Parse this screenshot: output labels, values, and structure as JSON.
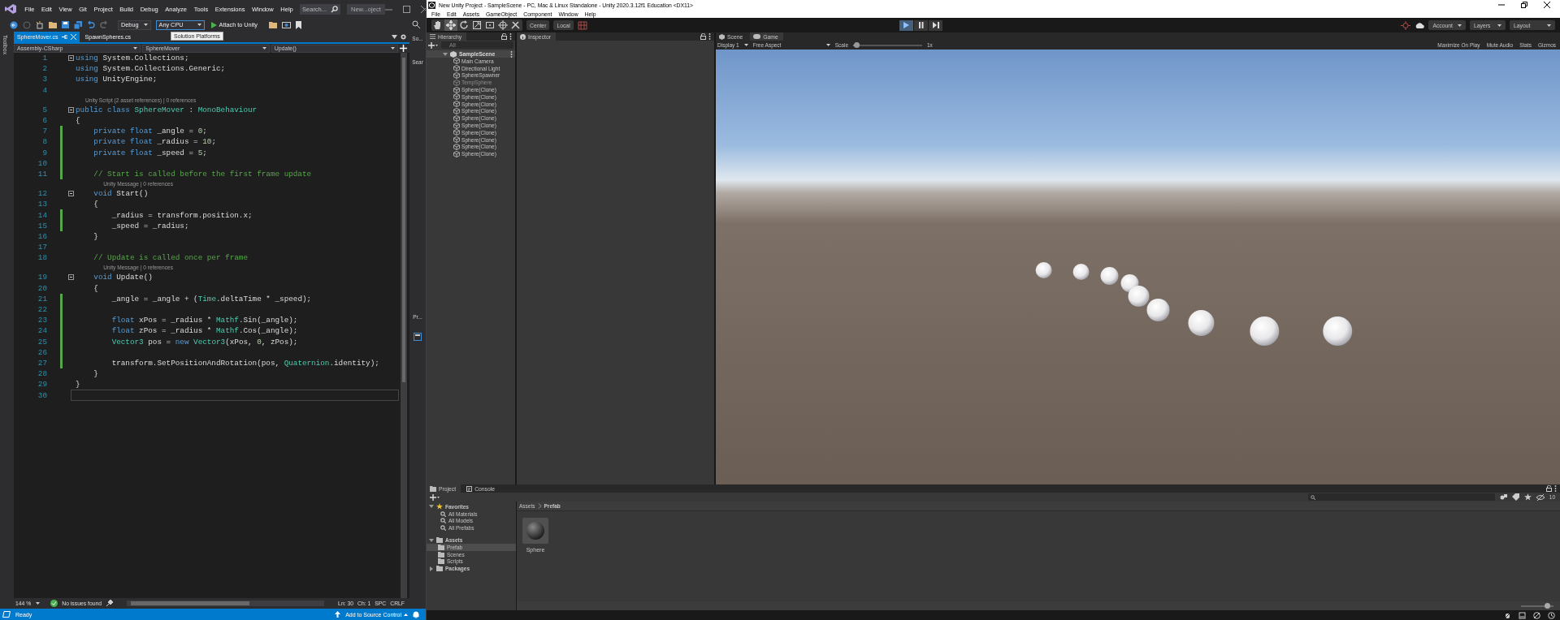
{
  "vs": {
    "menus": [
      "File",
      "Edit",
      "View",
      "Git",
      "Project",
      "Build",
      "Debug",
      "Analyze",
      "Tools",
      "Extensions",
      "Window",
      "Help"
    ],
    "search": {
      "placeholder": "Search..."
    },
    "title": "New...oject",
    "toolbar": {
      "configuration": "Debug",
      "platform": "Any CPU",
      "run_label": "Attach to Unity"
    },
    "tooltip": "Solution Platforms",
    "side_left": "Toolbox",
    "side_right": {
      "top": "So...",
      "search": "Sear",
      "bottom": "Pr..."
    },
    "tabs": [
      {
        "label": "SphereMover.cs",
        "selected": true
      },
      {
        "label": "SpawnSpheres.cs",
        "selected": false
      }
    ],
    "nav": {
      "project": "Assembly-CSharp",
      "type": "SphereMover",
      "member": "Update()"
    },
    "code": [
      {
        "number": "1",
        "foldable": true,
        "changed": false,
        "tokens": [
          {
            "kind": "kw",
            "text": "using"
          },
          {
            "kind": "plain",
            "text": " System.Collections;"
          }
        ]
      },
      {
        "number": "2",
        "foldable": false,
        "changed": false,
        "tokens": [
          {
            "kind": "kw",
            "text": "using"
          },
          {
            "kind": "plain",
            "text": " System.Collections.Generic;"
          }
        ]
      },
      {
        "number": "3",
        "foldable": false,
        "changed": false,
        "tokens": [
          {
            "kind": "kw",
            "text": "using"
          },
          {
            "kind": "plain",
            "text": " UnityEngine;"
          }
        ]
      },
      {
        "number": "4",
        "foldable": false,
        "changed": false
      },
      {
        "kind": "lens",
        "text": "Unity Script (2 asset references) | 0 references"
      },
      {
        "number": "5",
        "foldable": true,
        "changed": false,
        "tokens": [
          {
            "kind": "kw",
            "text": "public class "
          },
          {
            "kind": "type",
            "text": "SphereMover"
          },
          {
            "kind": "plain",
            "text": " : "
          },
          {
            "kind": "type",
            "text": "MonoBehaviour"
          }
        ]
      },
      {
        "number": "6",
        "foldable": false,
        "changed": false,
        "tokens": [
          {
            "kind": "plain",
            "text": "{"
          }
        ]
      },
      {
        "number": "7",
        "foldable": false,
        "changed": true,
        "tokens": [
          {
            "kind": "kw",
            "text": "    private float"
          },
          {
            "kind": "plain",
            "text": " _angle = "
          },
          {
            "kind": "num",
            "text": "0"
          },
          {
            "kind": "plain",
            "text": ";"
          }
        ]
      },
      {
        "number": "8",
        "foldable": false,
        "changed": true,
        "tokens": [
          {
            "kind": "kw",
            "text": "    private float"
          },
          {
            "kind": "plain",
            "text": " _radius = "
          },
          {
            "kind": "num",
            "text": "10"
          },
          {
            "kind": "plain",
            "text": ";"
          }
        ]
      },
      {
        "number": "9",
        "foldable": false,
        "changed": true,
        "tokens": [
          {
            "kind": "kw",
            "text": "    private float"
          },
          {
            "kind": "plain",
            "text": " _speed = "
          },
          {
            "kind": "num",
            "text": "5"
          },
          {
            "kind": "plain",
            "text": ";"
          }
        ]
      },
      {
        "number": "10",
        "foldable": false,
        "changed": true
      },
      {
        "number": "11",
        "foldable": false,
        "changed": true,
        "tokens": [
          {
            "kind": "comment",
            "text": "    // Start is called before the first frame update"
          }
        ]
      },
      {
        "kind": "lens",
        "text": "Unity Message | 0 references"
      },
      {
        "number": "12",
        "foldable": true,
        "changed": false,
        "tokens": [
          {
            "kind": "kw",
            "text": "    void"
          },
          {
            "kind": "plain",
            "text": " Start()"
          }
        ]
      },
      {
        "number": "13",
        "foldable": false,
        "changed": false,
        "tokens": [
          {
            "kind": "plain",
            "text": "    {"
          }
        ]
      },
      {
        "number": "14",
        "foldable": false,
        "changed": true,
        "tokens": [
          {
            "kind": "plain",
            "text": "        _radius = transform.position.x;"
          }
        ]
      },
      {
        "number": "15",
        "foldable": false,
        "changed": true,
        "tokens": [
          {
            "kind": "plain",
            "text": "        _speed = _radius;"
          }
        ]
      },
      {
        "number": "16",
        "foldable": false,
        "changed": false,
        "tokens": [
          {
            "kind": "plain",
            "text": "    }"
          }
        ]
      },
      {
        "number": "17",
        "foldable": false,
        "changed": false
      },
      {
        "number": "18",
        "foldable": false,
        "changed": false,
        "tokens": [
          {
            "kind": "comment",
            "text": "    // Update is called once per frame"
          }
        ]
      },
      {
        "kind": "lens",
        "text": "Unity Message | 0 references"
      },
      {
        "number": "19",
        "foldable": true,
        "changed": false,
        "tokens": [
          {
            "kind": "kw",
            "text": "    void"
          },
          {
            "kind": "plain",
            "text": " Update()"
          }
        ]
      },
      {
        "number": "20",
        "foldable": false,
        "changed": false,
        "tokens": [
          {
            "kind": "plain",
            "text": "    {"
          }
        ]
      },
      {
        "number": "21",
        "foldable": false,
        "changed": true,
        "tokens": [
          {
            "kind": "plain",
            "text": "        _angle = _angle + ("
          },
          {
            "kind": "type",
            "text": "Time"
          },
          {
            "kind": "plain",
            "text": ".deltaTime * _speed);"
          }
        ]
      },
      {
        "number": "22",
        "foldable": false,
        "changed": true
      },
      {
        "number": "23",
        "foldable": false,
        "changed": true,
        "tokens": [
          {
            "kind": "kw",
            "text": "        float"
          },
          {
            "kind": "plain",
            "text": " xPos = _radius * "
          },
          {
            "kind": "type",
            "text": "Mathf"
          },
          {
            "kind": "plain",
            "text": ".Sin(_angle);"
          }
        ]
      },
      {
        "number": "24",
        "foldable": false,
        "changed": true,
        "tokens": [
          {
            "kind": "kw",
            "text": "        float"
          },
          {
            "kind": "plain",
            "text": " zPos = _radius * "
          },
          {
            "kind": "type",
            "text": "Mathf"
          },
          {
            "kind": "plain",
            "text": ".Cos(_angle);"
          }
        ]
      },
      {
        "number": "25",
        "foldable": false,
        "changed": true,
        "tokens": [
          {
            "kind": "type",
            "text": "        Vector3"
          },
          {
            "kind": "plain",
            "text": " pos = "
          },
          {
            "kind": "kw",
            "text": "new "
          },
          {
            "kind": "type",
            "text": "Vector3"
          },
          {
            "kind": "plain",
            "text": "(xPos, "
          },
          {
            "kind": "num",
            "text": "0"
          },
          {
            "kind": "plain",
            "text": ", zPos);"
          }
        ]
      },
      {
        "number": "26",
        "foldable": false,
        "changed": true
      },
      {
        "number": "27",
        "foldable": false,
        "changed": true,
        "tokens": [
          {
            "kind": "plain",
            "text": "        transform.SetPositionAndRotation(pos, "
          },
          {
            "kind": "type",
            "text": "Quaternion"
          },
          {
            "kind": "plain",
            "text": ".identity);"
          }
        ]
      },
      {
        "number": "28",
        "foldable": false,
        "changed": false,
        "tokens": [
          {
            "kind": "plain",
            "text": "    }"
          }
        ]
      },
      {
        "number": "29",
        "foldable": false,
        "changed": false,
        "tokens": [
          {
            "kind": "plain",
            "text": "}"
          }
        ]
      },
      {
        "number": "30",
        "foldable": false,
        "changed": false,
        "current": true
      }
    ],
    "editor_status": {
      "zoom": "144 %",
      "issues": "No issues found",
      "line": "Ln: 30",
      "column": "Ch: 1",
      "whitespace": "SPC",
      "line_ending": "CRLF"
    },
    "status_bar": {
      "state": "Ready",
      "source_control": "Add to Source Control"
    }
  },
  "unity": {
    "title": "New Unity Project - SampleScene - PC, Mac & Linux Standalone - Unity 2020.3.12f1 Education <DX11>",
    "menus": [
      "File",
      "Edit",
      "Assets",
      "GameObject",
      "Component",
      "Window",
      "Help"
    ],
    "toolbar": {
      "pivot": "Center",
      "space": "Local",
      "playing": true,
      "paused": false,
      "account": "Account",
      "layers": "Layers",
      "layout": "Layout"
    },
    "hierarchy": {
      "title": "Hierarchy",
      "search": {
        "placeholder": "All"
      },
      "scene": "SampleScene",
      "expanded": true,
      "objects": [
        {
          "name": "Main Camera",
          "active": true
        },
        {
          "name": "Directional Light",
          "active": true
        },
        {
          "name": "SphereSpawner",
          "active": true
        },
        {
          "name": "TempSphere",
          "active": false
        },
        {
          "name": "Sphere(Clone)",
          "active": true
        },
        {
          "name": "Sphere(Clone)",
          "active": true
        },
        {
          "name": "Sphere(Clone)",
          "active": true
        },
        {
          "name": "Sphere(Clone)",
          "active": true
        },
        {
          "name": "Sphere(Clone)",
          "active": true
        },
        {
          "name": "Sphere(Clone)",
          "active": true
        },
        {
          "name": "Sphere(Clone)",
          "active": true
        },
        {
          "name": "Sphere(Clone)",
          "active": true
        },
        {
          "name": "Sphere(Clone)",
          "active": true
        },
        {
          "name": "Sphere(Clone)",
          "active": true
        }
      ]
    },
    "inspector": {
      "title": "Inspector"
    },
    "view_tabs": [
      {
        "label": "Scene",
        "selected": false
      },
      {
        "label": "Game",
        "selected": true
      }
    ],
    "game_toolbar": {
      "display": "Display 1",
      "aspect": "Free Aspect",
      "scale_label": "Scale",
      "scale": {
        "level": 0.05
      },
      "scale_value": "1x",
      "toggles": [
        {
          "label": "Maximize On Play",
          "on": false
        },
        {
          "label": "Mute Audio",
          "on": false
        },
        {
          "label": "Stats",
          "on": false
        },
        {
          "label": "Gizmos",
          "on": false
        }
      ]
    },
    "project": {
      "tabs": [
        {
          "label": "Project",
          "selected": true
        },
        {
          "label": "Console",
          "selected": false
        }
      ],
      "favorites": {
        "label": "Favorites",
        "expanded": true,
        "items": [
          "All Materials",
          "All Models",
          "All Prefabs"
        ]
      },
      "assets": {
        "label": "Assets",
        "expanded": true,
        "children": [
          {
            "label": "Prefab",
            "selected": true
          },
          {
            "label": "Scenes",
            "selected": false
          },
          {
            "label": "Scripts",
            "selected": false
          }
        ]
      },
      "packages": {
        "label": "Packages",
        "expanded": false
      },
      "breadcrumb": [
        "Assets",
        "Prefab"
      ],
      "items": [
        {
          "name": "Sphere"
        }
      ],
      "hidden_count": "10",
      "zoom": {
        "level": 0.8
      }
    }
  }
}
